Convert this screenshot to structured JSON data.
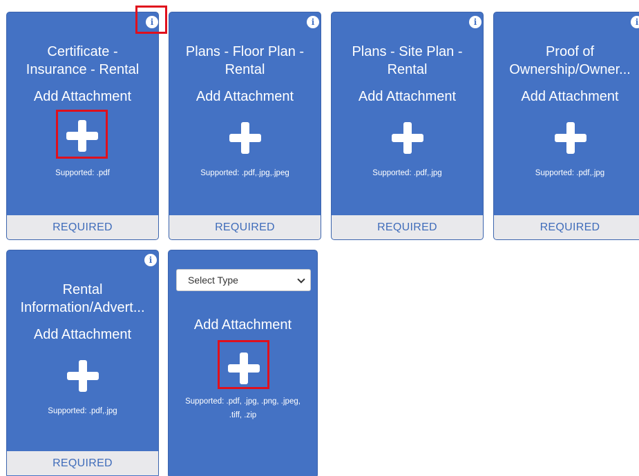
{
  "cards": [
    {
      "title_lines": [
        "Certificate -",
        "Insurance - Rental"
      ],
      "add_label": "Add Attachment",
      "supported": "Supported: .pdf",
      "required": "REQUIRED",
      "info_icon": "i"
    },
    {
      "title_lines": [
        "Plans - Floor Plan -",
        "Rental"
      ],
      "add_label": "Add Attachment",
      "supported": "Supported: .pdf,.jpg,.jpeg",
      "required": "REQUIRED",
      "info_icon": "i"
    },
    {
      "title_lines": [
        "Plans - Site Plan -",
        "Rental"
      ],
      "add_label": "Add Attachment",
      "supported": "Supported: .pdf,.jpg",
      "required": "REQUIRED",
      "info_icon": "i"
    },
    {
      "title_lines": [
        "Proof of",
        "Ownership/Owner..."
      ],
      "add_label": "Add Attachment",
      "supported": "Supported: .pdf,.jpg",
      "required": "REQUIRED",
      "info_icon": "i"
    },
    {
      "title_lines": [
        "Rental",
        "Information/Advert..."
      ],
      "add_label": "Add Attachment",
      "supported": "Supported: .pdf,.jpg",
      "required": "REQUIRED",
      "info_icon": "i"
    }
  ],
  "custom_card": {
    "select_value": "Select Type",
    "add_label": "Add Attachment",
    "supported_lines": [
      "Supported: .pdf, .jpg, .png, .jpeg,",
      ".tiff, .zip"
    ]
  },
  "colors": {
    "card_bg": "#4472c4",
    "required_bar_bg": "#e9e9ec",
    "required_text": "#3f6cba",
    "highlight": "#e0101c"
  },
  "icons": {
    "info": "info-icon",
    "add": "plus-icon",
    "dropdown": "chevron-down-icon"
  }
}
